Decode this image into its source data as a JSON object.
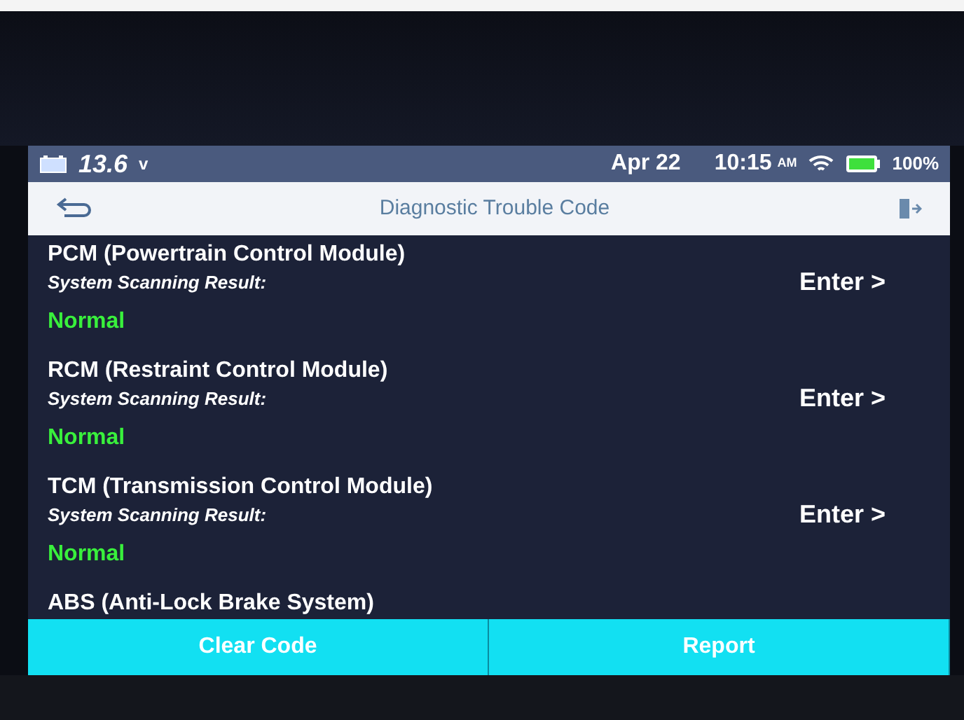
{
  "status_bar": {
    "voltage": "13.6",
    "voltage_unit": "v",
    "date": "Apr 22",
    "time": "10:15",
    "time_suffix": "AM",
    "battery_level": "100%"
  },
  "header": {
    "title": "Diagnostic Trouble Code"
  },
  "modules": [
    {
      "name": "PCM (Powertrain Control Module)",
      "result_label": "System Scanning Result:",
      "result": "Normal",
      "action": "Enter >"
    },
    {
      "name": "RCM (Restraint Control Module)",
      "result_label": "System Scanning Result:",
      "result": "Normal",
      "action": "Enter >"
    },
    {
      "name": "TCM (Transmission Control Module)",
      "result_label": "System Scanning Result:",
      "result": "Normal",
      "action": "Enter >"
    },
    {
      "name": "ABS (Anti-Lock Brake System)"
    }
  ],
  "buttons": [
    "Clear Code",
    "Report"
  ]
}
